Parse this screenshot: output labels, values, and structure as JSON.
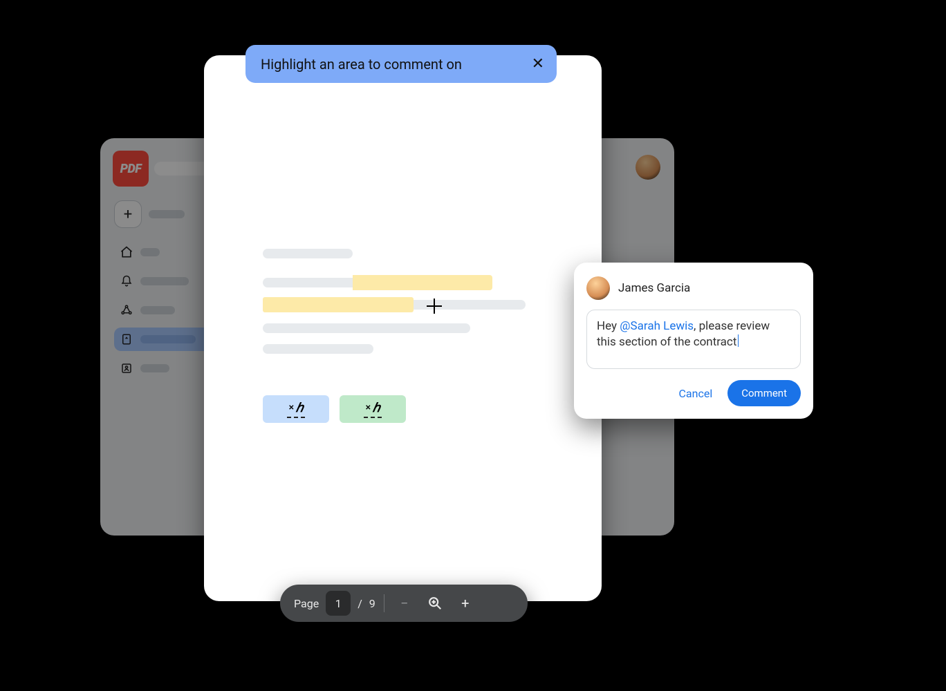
{
  "tooltip": {
    "text": "Highlight an area to comment on"
  },
  "app": {
    "logo_text": "PDF"
  },
  "sidebar": {
    "items": [
      {
        "icon": "plus"
      },
      {
        "icon": "home"
      },
      {
        "icon": "bell"
      },
      {
        "icon": "share"
      },
      {
        "icon": "doc",
        "active": true
      },
      {
        "icon": "tray"
      }
    ]
  },
  "page_control": {
    "label": "Page",
    "current": "1",
    "sep": "/",
    "total": "9"
  },
  "comment": {
    "author": "James Garcia",
    "pre": "Hey ",
    "mention": "@Sarah Lewis",
    "post": ", please review this section of the contract",
    "cancel": "Cancel",
    "submit": "Comment"
  }
}
